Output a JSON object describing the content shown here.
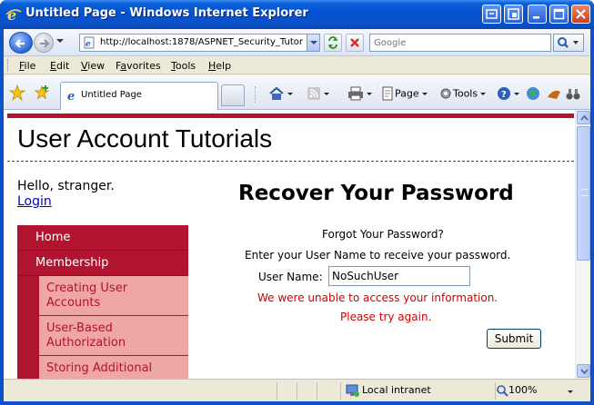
{
  "window": {
    "title": "Untitled Page - Windows Internet Explorer"
  },
  "address_bar": {
    "url": "http://localhost:1878/ASPNET_Security_Tutor",
    "search_placeholder": "Google"
  },
  "menu": {
    "items": [
      "File",
      "Edit",
      "View",
      "Favorites",
      "Tools",
      "Help"
    ],
    "mnemonics": [
      "F",
      "E",
      "V",
      "a",
      "T",
      "H"
    ]
  },
  "tabs": {
    "active_label": "Untitled Page"
  },
  "command_bar": {
    "page_label": "Page",
    "tools_label": "Tools"
  },
  "page": {
    "site_title": "User Account Tutorials",
    "greeting": "Hello, stranger.",
    "login_link": "Login",
    "nav": {
      "items": [
        {
          "label": "Home"
        },
        {
          "label": "Membership"
        }
      ],
      "sub_items": [
        {
          "label": "Creating User Accounts"
        },
        {
          "label": "User-Based Authorization"
        },
        {
          "label": "Storing Additional"
        }
      ]
    },
    "heading": "Recover Your Password",
    "prompt_title": "Forgot Your Password?",
    "prompt_text": "Enter your User Name to receive your password.",
    "username_label": "User Name:",
    "username_value": "NoSuchUser",
    "error_line1": "We were unable to access your information.",
    "error_line2": "Please try again.",
    "submit_label": "Submit"
  },
  "status_bar": {
    "zone": "Local intranet",
    "zoom": "100%"
  },
  "colors": {
    "brand": "#b0142f",
    "nav_sub_bg": "#eea7a4",
    "error": "#d00000",
    "link": "#0000cc"
  }
}
